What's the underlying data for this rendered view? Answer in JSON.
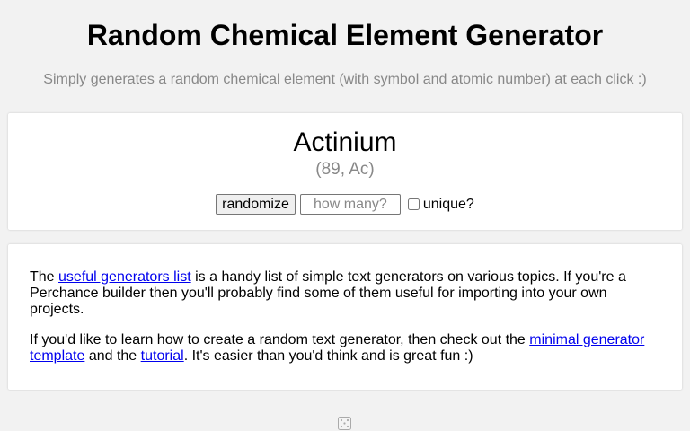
{
  "header": {
    "title": "Random Chemical Element Generator",
    "subtitle": "Simply generates a random chemical element (with symbol and atomic number) at each click :)"
  },
  "result": {
    "element_name": "Actinium",
    "element_detail": "(89, Ac)"
  },
  "controls": {
    "randomize_label": "randomize",
    "count_placeholder": "how many?",
    "count_value": "",
    "unique_label": "unique?",
    "unique_checked": false
  },
  "info": {
    "para1_before": "The ",
    "para1_link": "useful generators list",
    "para1_after": " is a handy list of simple text generators on various topics. If you're a Perchance builder then you'll probably find some of them useful for importing into your own projects.",
    "para2_before": "If you'd like to learn how to create a random text generator, then check out the ",
    "para2_link1": "minimal generator template",
    "para2_mid": " and the ",
    "para2_link2": "tutorial",
    "para2_after": ". It's easier than you'd think and is great fun :)"
  },
  "footer": {
    "icon": "dice-icon"
  },
  "colors": {
    "background": "#f2f2f2",
    "card": "#ffffff",
    "link": "#0000ee",
    "muted_text": "#888888"
  }
}
